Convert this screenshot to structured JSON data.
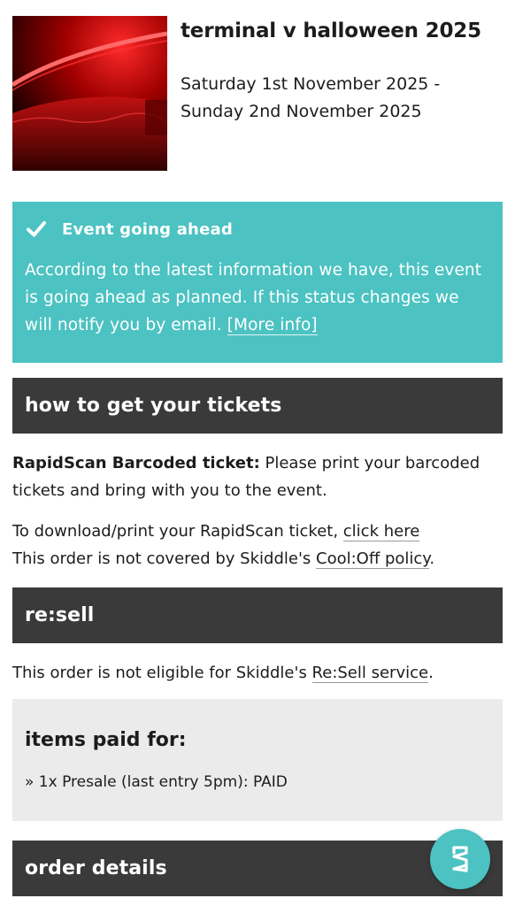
{
  "event": {
    "title": "terminal v halloween 2025",
    "dates": "Saturday 1st November 2025 - Sunday 2nd November 2025"
  },
  "status": {
    "title": "Event going ahead",
    "body": "According to the latest information we have, this event is going ahead as planned. If this status changes we will notify you by email. ",
    "link": "[More info]",
    "color": "#4cc2c2"
  },
  "tickets": {
    "heading": "how to get your tickets",
    "type_label": "RapidScan Barcoded ticket:",
    "type_text": " Please print your barcoded tickets and bring with you to the event.",
    "download_text": "To download/print your RapidScan ticket, ",
    "download_link": "click here",
    "cooloff_text": "This order is not covered by Skiddle's ",
    "cooloff_link": "Cool:Off policy",
    "cooloff_end": "."
  },
  "resell": {
    "heading": "re:sell",
    "text": "This order is not eligible for Skiddle's ",
    "link": "Re:Sell service",
    "end": "."
  },
  "items": {
    "heading": "items paid for:",
    "row": "» 1x Presale (last entry 5pm): PAID"
  },
  "order": {
    "heading": "order details"
  },
  "icons": {
    "check": "check-icon",
    "fab": "skiddle-logo-icon"
  },
  "colors": {
    "section_bar": "#3a3a3a",
    "items_bg": "#ebebeb",
    "accent": "#4cc2c2"
  }
}
